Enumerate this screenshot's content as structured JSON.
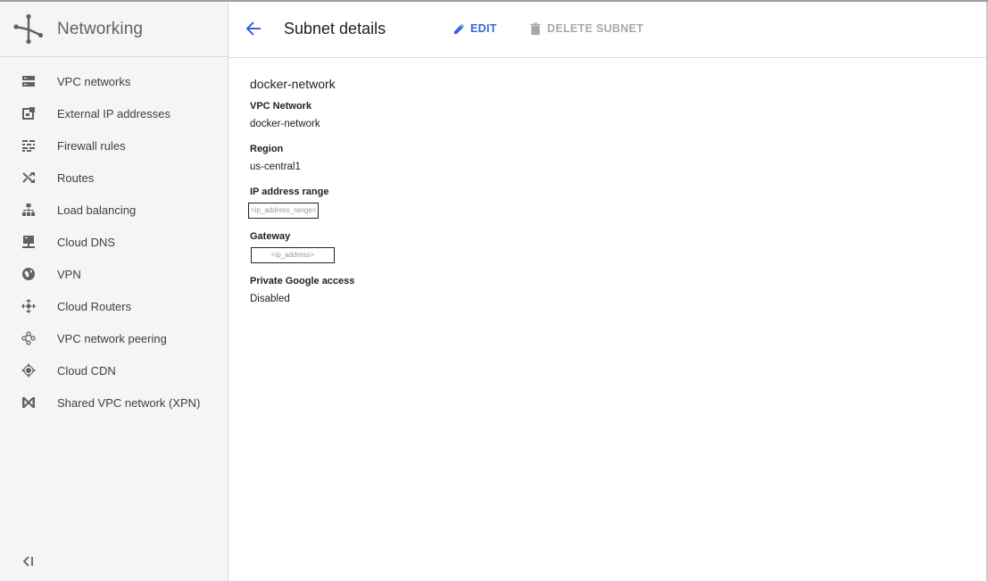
{
  "app": {
    "title": "Networking"
  },
  "sidebar": {
    "items": [
      {
        "label": "VPC networks",
        "icon": "vpc-networks-icon"
      },
      {
        "label": "External IP addresses",
        "icon": "external-ip-icon"
      },
      {
        "label": "Firewall rules",
        "icon": "firewall-icon"
      },
      {
        "label": "Routes",
        "icon": "routes-icon"
      },
      {
        "label": "Load balancing",
        "icon": "load-balancing-icon"
      },
      {
        "label": "Cloud DNS",
        "icon": "cloud-dns-icon"
      },
      {
        "label": "VPN",
        "icon": "vpn-icon"
      },
      {
        "label": "Cloud Routers",
        "icon": "cloud-routers-icon"
      },
      {
        "label": "VPC network peering",
        "icon": "peering-icon"
      },
      {
        "label": "Cloud CDN",
        "icon": "cloud-cdn-icon"
      },
      {
        "label": "Shared VPC network (XPN)",
        "icon": "shared-vpc-icon"
      }
    ],
    "collapse_icon": "collapse-sidebar-icon"
  },
  "header": {
    "title": "Subnet details",
    "edit_label": "EDIT",
    "delete_label": "DELETE SUBNET"
  },
  "subnet": {
    "name": "docker-network",
    "fields": {
      "vpc_network": {
        "label": "VPC Network",
        "value": "docker-network"
      },
      "region": {
        "label": "Region",
        "value": "us-central1"
      },
      "ip_range": {
        "label": "IP address range",
        "value": "<ip_address_range>"
      },
      "gateway": {
        "label": "Gateway",
        "value": "<ip_address>"
      },
      "private_access": {
        "label": "Private Google access",
        "value": "Disabled"
      }
    }
  },
  "colors": {
    "accent": "#3367d6",
    "disabled": "#a8a8a8",
    "sidebar_bg": "#f5f5f5",
    "icon": "#5f6368"
  }
}
